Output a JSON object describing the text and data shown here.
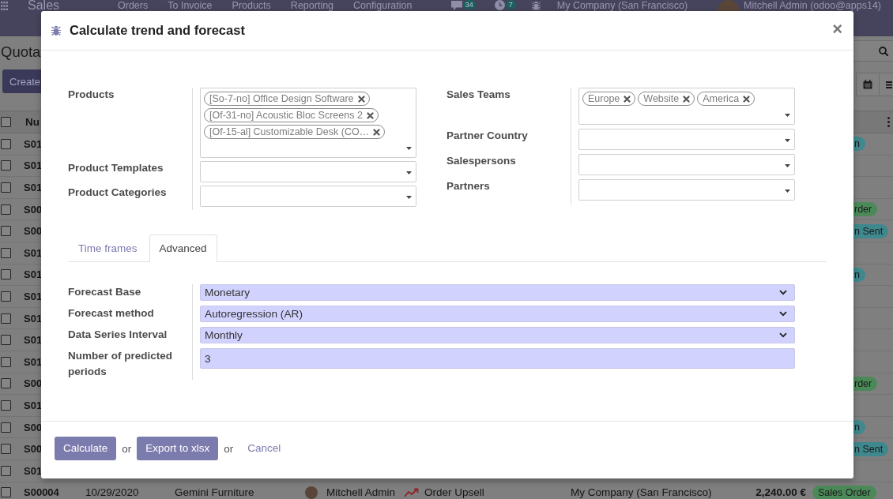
{
  "navbar": {
    "app_name": "Sales",
    "menu_items": [
      "Orders",
      "To Invoice",
      "Products",
      "Reporting",
      "Configuration"
    ],
    "messages_count": "34",
    "activities_count": "7",
    "company": "My Company (San Francisco)",
    "user": "Mitchell Admin (odoo@apps14)"
  },
  "control_panel": {
    "title": "Quota",
    "create_button": "Create"
  },
  "list": {
    "header": {
      "checked": false,
      "column_1": "Nu"
    },
    "rows": [
      {
        "checked": false,
        "number": "S01",
        "status": {
          "text": "n",
          "color": "#3e888e"
        }
      },
      {
        "checked": false,
        "number": "S01"
      },
      {
        "checked": false,
        "number": "S01"
      },
      {
        "checked": false,
        "number": "S00",
        "status": {
          "text": "rder",
          "color": "#4b8a58"
        }
      },
      {
        "checked": false,
        "number": "S00",
        "status": {
          "text": "n Sent",
          "color": "#3e888e"
        }
      },
      {
        "checked": false,
        "number": "S01"
      },
      {
        "checked": false,
        "number": "S01",
        "status": {
          "text": "n",
          "color": "#3e888e"
        }
      },
      {
        "checked": false,
        "number": "S01"
      },
      {
        "checked": false,
        "number": "S01"
      },
      {
        "checked": false,
        "number": "S01"
      },
      {
        "checked": false,
        "number": "S01"
      },
      {
        "checked": false,
        "number": "S00",
        "status": {
          "text": "rder",
          "color": "#4b8a58"
        }
      },
      {
        "checked": false,
        "number": "S01"
      },
      {
        "checked": false,
        "number": "S00",
        "status": {
          "text": "n",
          "color": "#3e888e"
        }
      },
      {
        "checked": false,
        "number": "S00",
        "status": {
          "text": "n Sent",
          "color": "#3e888e"
        }
      },
      {
        "checked": false,
        "number": "S01"
      },
      {
        "checked": false,
        "number": "S00004",
        "date": "10/29/2020",
        "customer": "Gemini Furniture",
        "salesperson": "Mitchell Admin",
        "activity": "Order Upsell",
        "company": "My Company (San Francisco)",
        "total": "2,240.00 €",
        "status": {
          "text": "Sales Order",
          "color": "#4b8a58"
        }
      }
    ]
  },
  "dialog": {
    "title": "Calculate trend and forecast",
    "close": "×",
    "left_fields": [
      {
        "label": "Products",
        "tags": [
          "[So-7-no] Office Design Software",
          "[Of-31-no] Acoustic Bloc Screens 2",
          "[Of-15-al] Customizable Desk (CO…"
        ]
      },
      {
        "label": "Product Templates"
      },
      {
        "label": "Product Categories"
      }
    ],
    "right_fields": [
      {
        "label": "Sales Teams",
        "tags": [
          "Europe",
          "Website",
          "America"
        ]
      },
      {
        "label": "Partner Country"
      },
      {
        "label": "Salespersons"
      },
      {
        "label": "Partners"
      }
    ],
    "tabs": [
      {
        "label": "Time frames",
        "selected": false
      },
      {
        "label": "Advanced",
        "selected": true
      }
    ],
    "advanced_fields": [
      {
        "label": "Forecast Base",
        "kind": "select",
        "value": "Monetary"
      },
      {
        "label": "Forecast method",
        "kind": "select",
        "value": "Autoregression (AR)"
      },
      {
        "label": "Data Series Interval",
        "kind": "select",
        "value": "Monthly"
      },
      {
        "label": "Number of predicted periods",
        "kind": "input",
        "value": "3"
      }
    ],
    "footer": [
      {
        "kind": "button",
        "label": "Calculate"
      },
      {
        "kind": "text",
        "label": "or"
      },
      {
        "kind": "button",
        "label": "Export to xlsx"
      },
      {
        "kind": "text",
        "label": "or"
      },
      {
        "kind": "link",
        "label": "Cancel"
      }
    ]
  }
}
